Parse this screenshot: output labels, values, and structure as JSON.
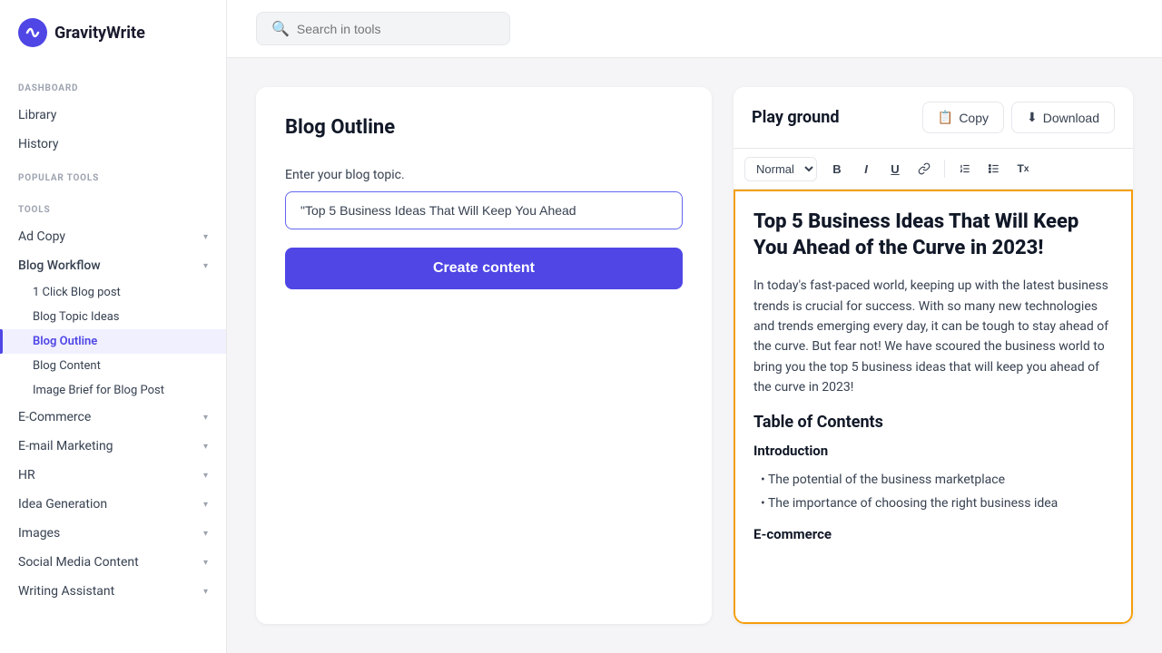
{
  "logo": {
    "text": "GravityWrite"
  },
  "search": {
    "placeholder": "Search in tools"
  },
  "sidebar": {
    "dashboard_label": "DASHBOARD",
    "library": "Library",
    "history": "History",
    "popular_tools_label": "POPULAR TOOLS",
    "tools_label": "TOOLS",
    "items": [
      {
        "id": "ad-copy",
        "label": "Ad Copy",
        "expandable": true
      },
      {
        "id": "blog-workflow",
        "label": "Blog Workflow",
        "expandable": true,
        "expanded": true
      },
      {
        "id": "1-click-blog",
        "label": "1 Click Blog post",
        "sub": true
      },
      {
        "id": "blog-topic-ideas",
        "label": "Blog Topic Ideas",
        "sub": true
      },
      {
        "id": "blog-outline",
        "label": "Blog Outline",
        "sub": true,
        "active": true
      },
      {
        "id": "blog-content",
        "label": "Blog Content",
        "sub": true
      },
      {
        "id": "image-brief",
        "label": "Image Brief for Blog Post",
        "sub": true
      },
      {
        "id": "e-commerce",
        "label": "E-Commerce",
        "expandable": true
      },
      {
        "id": "email-marketing",
        "label": "E-mail Marketing",
        "expandable": true
      },
      {
        "id": "hr",
        "label": "HR",
        "expandable": true
      },
      {
        "id": "idea-generation",
        "label": "Idea Generation",
        "expandable": true
      },
      {
        "id": "images",
        "label": "Images",
        "expandable": true
      },
      {
        "id": "social-media",
        "label": "Social Media Content",
        "expandable": true
      },
      {
        "id": "writing-assistant",
        "label": "Writing Assistant",
        "expandable": true
      }
    ]
  },
  "left_panel": {
    "title": "Blog Outline",
    "field_label": "Enter your blog topic.",
    "input_value": "\"Top 5 Business Ideas That Will Keep You Ahead",
    "create_button": "Create content"
  },
  "right_panel": {
    "title": "Play ground",
    "copy_button": "Copy",
    "download_button": "Download",
    "toolbar": {
      "format_select": "Normal",
      "bold": "B",
      "italic": "I",
      "underline": "U",
      "link": "🔗",
      "ol": "≡",
      "ul": "☰",
      "clear": "Tx"
    },
    "content": {
      "heading": "Top 5 Business Ideas That Will Keep You Ahead of the Curve in 2023!",
      "intro": "In today's fast-paced world, keeping up with the latest business trends is crucial for success. With so many new technologies and trends emerging every day, it can be tough to stay ahead of the curve. But fear not! We have scoured the business world to bring you the top 5 business ideas that will keep you ahead of the curve in 2023!",
      "toc_heading": "Table of Contents",
      "intro_section": "Introduction",
      "bullet1": "The potential of the business marketplace",
      "bullet2": "The importance of choosing the right business idea",
      "ecommerce_heading": "E-commerce"
    }
  }
}
